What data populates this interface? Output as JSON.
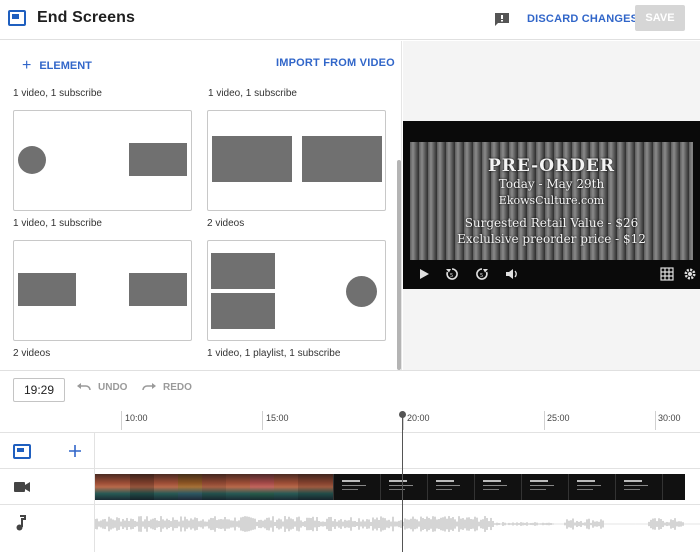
{
  "header": {
    "title": "End Screens",
    "discard_label": "DISCARD CHANGES",
    "save_label": "SAVE",
    "colors": {
      "accent": "#3166c9",
      "save_disabled": "#d6d6d6"
    }
  },
  "templates": {
    "add_element_label": "ELEMENT",
    "import_label": "IMPORT FROM VIDEO",
    "top_captions": [
      "1 video, 1 subscribe",
      "1 video, 1 subscribe"
    ],
    "items": [
      {
        "caption": "1 video, 1 subscribe"
      },
      {
        "caption": "2 videos"
      },
      {
        "caption": "2 videos"
      },
      {
        "caption": "1 video, 1 playlist, 1 subscribe"
      }
    ]
  },
  "preview": {
    "line1": "PRE-ORDER",
    "line2": "Today - May 29th",
    "line3": "EkowsCulture.com",
    "line4": "Surgested Retail Value - $26",
    "line5": "Exclulsive preorder price - $12",
    "controls": [
      "play-icon",
      "rewind-icon",
      "forward-icon",
      "volume-icon",
      "grid-icon",
      "settings-icon"
    ]
  },
  "timeline": {
    "current_time": "19:29",
    "undo_label": "UNDO",
    "redo_label": "REDO",
    "ticks": [
      "10:00",
      "15:00",
      "20:00",
      "25:00",
      "30:00"
    ],
    "track_icons": [
      "end-screen-icon",
      "video-camera-icon",
      "music-note-icon"
    ]
  }
}
